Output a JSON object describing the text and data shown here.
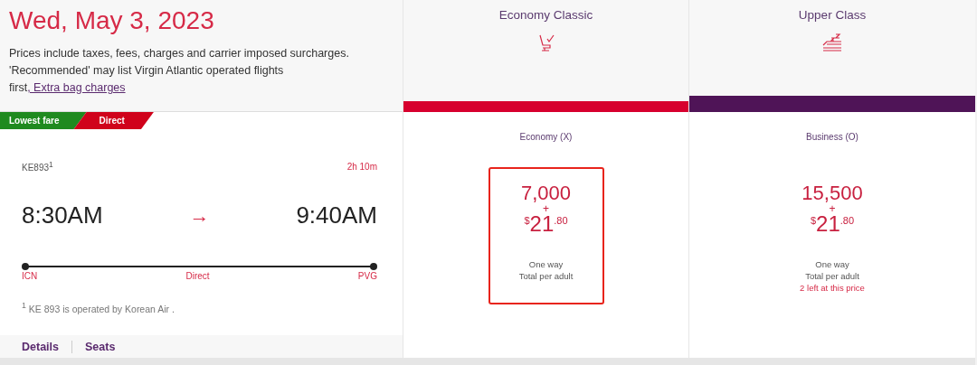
{
  "date": "Wed, May 3, 2023",
  "notice": {
    "text": "Prices include taxes, fees, charges and carrier imposed surcharges. 'Recommended' may list Virgin Atlantic operated flights first",
    "link": ", Extra bag charges"
  },
  "tags": [
    {
      "label": "Lowest fare",
      "color": "#1f8a1f"
    },
    {
      "label": "Direct",
      "color": "#d0021b"
    }
  ],
  "flight": {
    "number": "KE893",
    "note_mark": "1",
    "duration": "2h 10m",
    "depart_time": "8:30AM",
    "arrow": "→",
    "arrive_time": "9:40AM",
    "origin": "ICN",
    "stops": "Direct",
    "destination": "PVG",
    "footnote_mark": "1",
    "footnote": "KE 893 is operated by Korean Air ."
  },
  "actions": [
    {
      "label": "Details"
    },
    {
      "label": "Seats"
    }
  ],
  "cabins": [
    {
      "name": "Economy Classic",
      "kind": "seat",
      "color": "#d7002e",
      "fare": {
        "fare_class": "Economy (X)",
        "points": "7,000",
        "plus": "+",
        "currency": "$",
        "dollars": "21",
        "cents": ".80",
        "trip": "One way",
        "basis": "Total per adult",
        "selected": true
      }
    },
    {
      "name": "Upper Class",
      "kind": "bed",
      "color": "#4f1457",
      "fare": {
        "fare_class": "Business (O)",
        "points": "15,500",
        "plus": "+",
        "currency": "$",
        "dollars": "21",
        "cents": ".80",
        "trip": "One way",
        "basis": "Total per adult",
        "availability": "2 left at this price",
        "selected": false
      }
    }
  ]
}
